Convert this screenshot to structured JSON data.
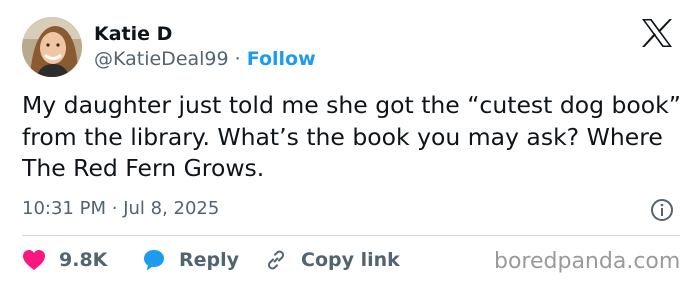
{
  "author": {
    "display_name": "Katie D",
    "handle": "@KatieDeal99",
    "separator": "·",
    "follow_label": "Follow"
  },
  "tweet": {
    "text": "My daughter just told me she got the “cutest dog book” from the library. What’s the book you may ask? Where The Red Fern Grows.",
    "time": "10:31 PM",
    "meta_separator": "·",
    "date": "Jul 8, 2025"
  },
  "actions": {
    "likes_count": "9.8K",
    "reply_label": "Reply",
    "copy_link_label": "Copy link"
  },
  "icons": {
    "logo": "x-logo-icon",
    "info": "info-icon",
    "like": "heart-icon",
    "reply": "speech-bubble-icon",
    "copy": "link-icon"
  },
  "colors": {
    "text": "#0f1419",
    "secondary": "#536471",
    "accent": "#1d9bf0",
    "like": "#f91880",
    "divider": "#cfd9de"
  },
  "watermark": "boredpanda.com"
}
